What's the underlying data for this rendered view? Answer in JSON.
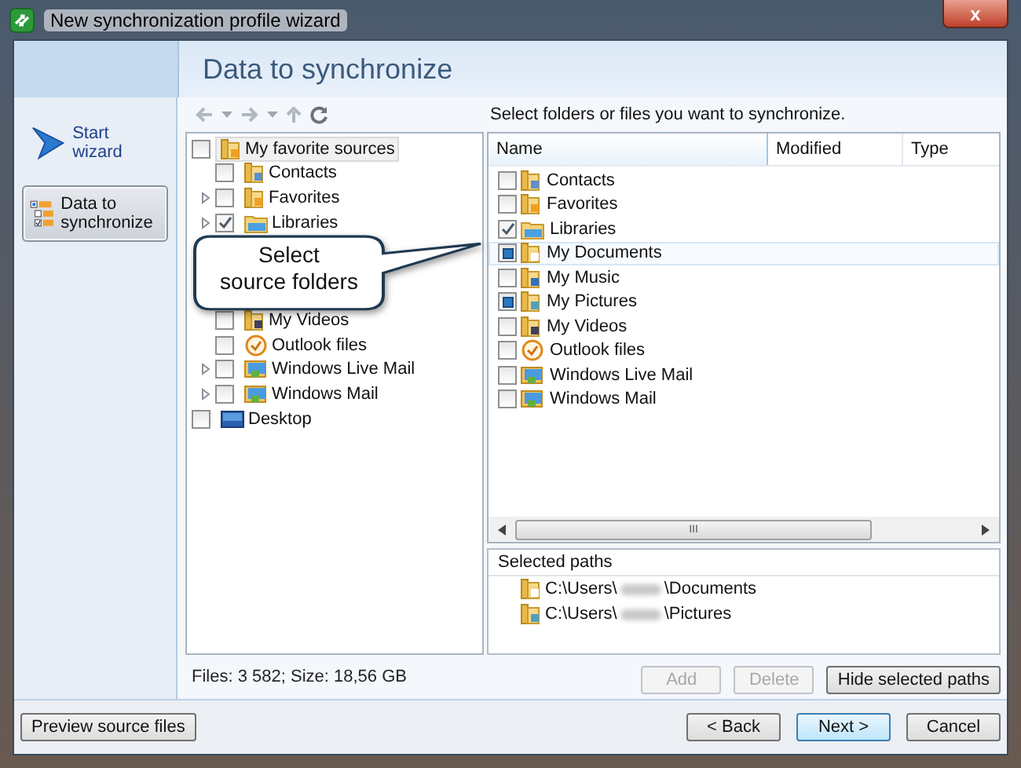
{
  "window": {
    "title": "New synchronization profile wizard",
    "close": "x"
  },
  "header": {
    "title": "Data to synchronize"
  },
  "steps": [
    {
      "label": "Start wizard",
      "kind": "arrow",
      "selected": false
    },
    {
      "label": "Data to synchronize",
      "kind": "tree",
      "selected": true
    }
  ],
  "tree": {
    "items": [
      {
        "label": "My favorite sources",
        "kind": "favorites",
        "checked": false,
        "partial": false,
        "selected": true,
        "children": [
          {
            "label": "Contacts",
            "kind": "contacts",
            "checked": false,
            "partial": false,
            "expandable": false
          },
          {
            "label": "Favorites",
            "kind": "favorites",
            "checked": false,
            "partial": false,
            "expandable": true
          },
          {
            "label": "Libraries",
            "kind": "libraries",
            "checked": true,
            "partial": false,
            "expandable": true
          },
          {
            "kind": "callout",
            "text": "Select\nsource folders"
          },
          {
            "label": "My Videos",
            "kind": "videos",
            "checked": false,
            "partial": false,
            "expandable": false
          },
          {
            "label": "Outlook files",
            "kind": "outlook",
            "checked": false,
            "partial": false,
            "expandable": false
          },
          {
            "label": "Windows Live Mail",
            "kind": "mail",
            "checked": false,
            "partial": false,
            "expandable": true
          },
          {
            "label": "Windows Mail",
            "kind": "mail",
            "checked": false,
            "partial": false,
            "expandable": true
          }
        ]
      },
      {
        "label": "Desktop",
        "kind": "desktop",
        "checked": false,
        "partial": false,
        "selected": false
      }
    ]
  },
  "status": "Files: 3 582; Size: 18,56 GB",
  "instruction": "Select folders or files you want to synchronize.",
  "list": {
    "columns": [
      "Name",
      "Modified",
      "Type"
    ],
    "rows": [
      {
        "name": "Contacts",
        "kind": "contacts",
        "checked": false,
        "partial": false,
        "selected": false
      },
      {
        "name": "Favorites",
        "kind": "favorites",
        "checked": false,
        "partial": false,
        "selected": false
      },
      {
        "name": "Libraries",
        "kind": "libraries",
        "checked": true,
        "partial": false,
        "selected": false
      },
      {
        "name": "My Documents",
        "kind": "documents",
        "checked": false,
        "partial": true,
        "selected": true
      },
      {
        "name": "My Music",
        "kind": "music",
        "checked": false,
        "partial": false,
        "selected": false
      },
      {
        "name": "My Pictures",
        "kind": "pictures",
        "checked": false,
        "partial": true,
        "selected": false
      },
      {
        "name": "My Videos",
        "kind": "videos",
        "checked": false,
        "partial": false,
        "selected": false
      },
      {
        "name": "Outlook files",
        "kind": "outlook",
        "checked": false,
        "partial": false,
        "selected": false
      },
      {
        "name": "Windows Live Mail",
        "kind": "mail",
        "checked": false,
        "partial": false,
        "selected": false
      },
      {
        "name": "Windows Mail",
        "kind": "mail",
        "checked": false,
        "partial": false,
        "selected": false
      }
    ],
    "scroll_thumb": "III"
  },
  "selected_paths": {
    "title": "Selected paths",
    "paths": [
      {
        "start": "C:\\Users\\",
        "end": "\\Documents",
        "kind": "documents"
      },
      {
        "start": "C:\\Users\\",
        "end": "\\Pictures",
        "kind": "pictures"
      }
    ]
  },
  "path_buttons": [
    {
      "label": "Add",
      "disabled": true
    },
    {
      "label": "Delete",
      "disabled": true
    },
    {
      "label": "Hide selected paths",
      "disabled": false
    }
  ],
  "footer": {
    "left": [
      {
        "label": "Preview source files",
        "default": false
      }
    ],
    "right": [
      {
        "label": "< Back",
        "default": false
      },
      {
        "label": "Next >",
        "default": true
      },
      {
        "label": "Cancel",
        "default": false
      }
    ]
  }
}
